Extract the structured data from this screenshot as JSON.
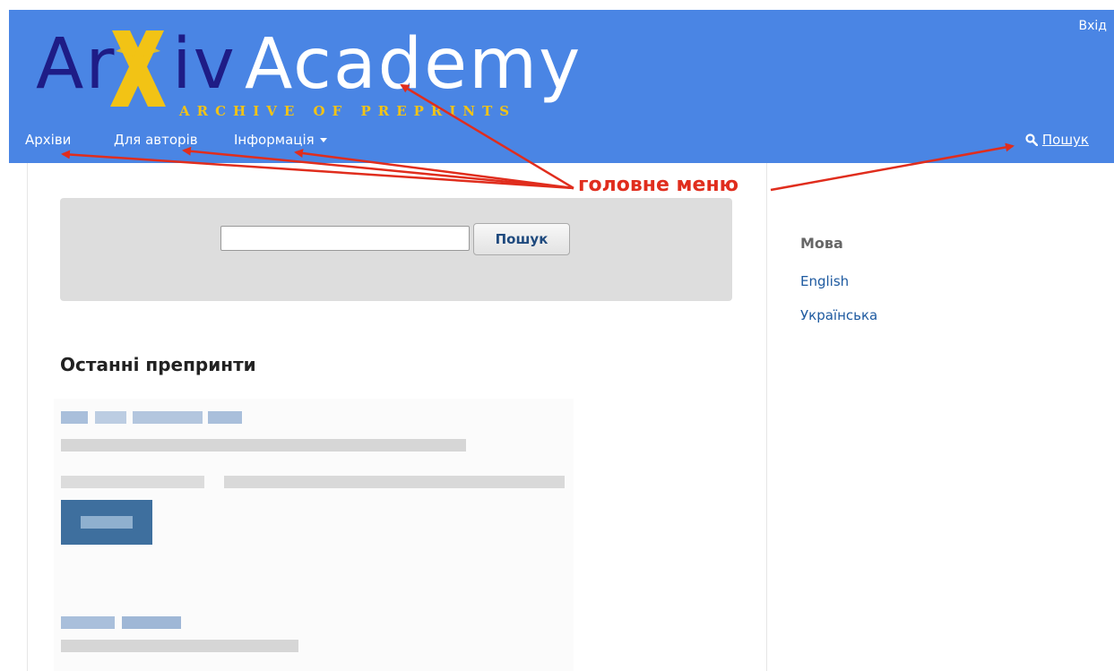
{
  "header": {
    "login_label": "Вхід",
    "logo": {
      "part_ar": "Ar",
      "part_iv": "iv",
      "part_academy": "Academy",
      "tagline": "ARCHIVE OF PREPRINTS"
    },
    "nav": {
      "items": [
        {
          "label": "Архіви"
        },
        {
          "label": "Для авторів"
        },
        {
          "label": "Інформація"
        }
      ],
      "search_label": "Пошук"
    }
  },
  "search": {
    "input_value": "",
    "button_label": "Пошук"
  },
  "main": {
    "section_title": "Останні препринти"
  },
  "sidebar": {
    "title": "Мова",
    "languages": [
      {
        "label": "English"
      },
      {
        "label": "Українська"
      }
    ]
  },
  "annotation": {
    "label": "головне меню",
    "color": "#e02d1d"
  },
  "colors": {
    "header_bg": "#4a85e4",
    "logo_dark": "#1e1c86",
    "logo_gold": "#f2c315",
    "link": "#1e5aa0"
  }
}
